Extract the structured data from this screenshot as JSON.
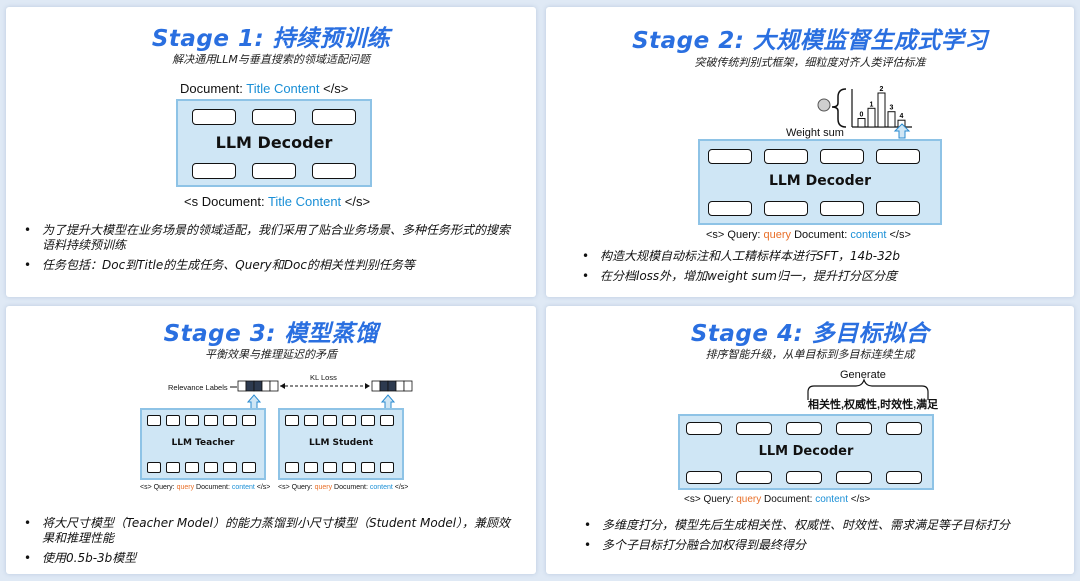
{
  "stage1": {
    "title": "Stage 1:  持续预训练",
    "subtitle": "解决通用LLM与垂直搜索的领域适配问题",
    "top_caption": {
      "prefix": "Document: ",
      "highlight": "Title Content",
      "suffix": " </s>"
    },
    "decoder_label": "LLM Decoder",
    "bottom_caption": {
      "prefix": "<s Document: ",
      "highlight": "Title Content",
      "suffix": " </s>"
    },
    "bullets": [
      "为了提升大模型在业务场景的领域适配，我们采用了贴合业务场景、多种任务形式的搜索语料持续预训练",
      "任务包括：Doc到Title的生成任务、Query和Doc的相关性判别任务等"
    ]
  },
  "stage2": {
    "title": "Stage 2:  大规模监督生成式学习",
    "subtitle": "突破传统判别式框架，细粒度对齐人类评估标准",
    "weight_sum": "Weight sum",
    "bar_labels": [
      "0",
      "1",
      "2",
      "3",
      "4"
    ],
    "bar_values": [
      0.25,
      0.55,
      1.0,
      0.45,
      0.2
    ],
    "decoder_label": "LLM Decoder",
    "caption": {
      "prefix": "<s> Query: ",
      "query": "query",
      "mid": " Document: ",
      "content": "content",
      "suffix": " </s>"
    },
    "bullets": [
      "构造大规模自动标注和人工精标样本进行SFT，14b-32b",
      "在分档loss外，增加weight sum归一，提升打分区分度"
    ]
  },
  "stage3": {
    "title": "Stage 3:  模型蒸馏",
    "subtitle": "平衡效果与推理延迟的矛盾",
    "relevance_labels": "Relevance Labels",
    "kl_loss": "KL Loss",
    "teacher_label": "LLM Teacher",
    "student_label": "LLM Student",
    "caption": {
      "prefix": "<s> Query: ",
      "query": "query",
      "mid": " Document: ",
      "content": "content",
      "suffix": " </s>"
    },
    "bullets": [
      "将大尺寸模型（Teacher Model）的能力蒸馏到小尺寸模型（Student Model），兼顾效果和推理性能",
      "使用0.5b-3b模型"
    ]
  },
  "stage4": {
    "title": "Stage 4:  多目标拟合",
    "subtitle": "排序智能升级，从单目标到多目标连续生成",
    "generate": "Generate",
    "targets": "相关性,权威性,时效性,满足",
    "decoder_label": "LLM Decoder",
    "caption": {
      "prefix": "<s> Query: ",
      "query": "query",
      "mid": " Document: ",
      "content": "content",
      "suffix": " </s>"
    },
    "bullets": [
      "多维度打分，模型先后生成相关性、权威性、时效性、需求满足等子目标打分",
      "多个子目标打分融合加权得到最终得分"
    ]
  },
  "colors": {
    "title": "#2a6fe0",
    "highlight_blue": "#1a8fd6",
    "highlight_orange": "#e8702a",
    "decoder_fill": "#cfe6f5"
  }
}
